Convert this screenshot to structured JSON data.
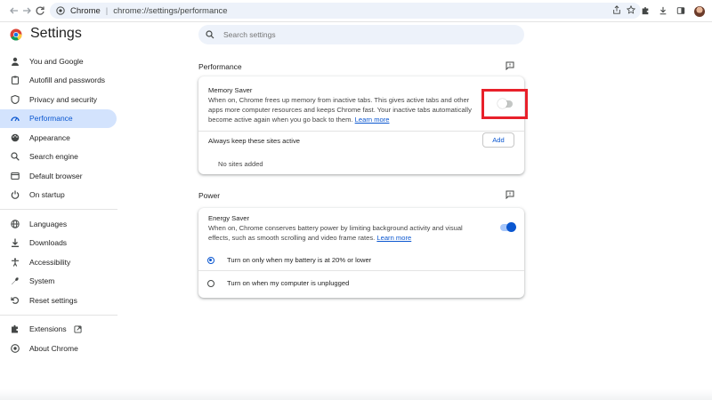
{
  "browser": {
    "chip_label": "Chrome",
    "url": "chrome://settings/performance"
  },
  "header": {
    "title": "Settings",
    "search_placeholder": "Search settings"
  },
  "sidebar": {
    "items": [
      {
        "label": "You and Google",
        "icon": "person-icon"
      },
      {
        "label": "Autofill and passwords",
        "icon": "clipboard-icon"
      },
      {
        "label": "Privacy and security",
        "icon": "shield-icon"
      },
      {
        "label": "Performance",
        "icon": "speedometer-icon",
        "active": true
      },
      {
        "label": "Appearance",
        "icon": "palette-icon"
      },
      {
        "label": "Search engine",
        "icon": "search-icon"
      },
      {
        "label": "Default browser",
        "icon": "browser-icon"
      },
      {
        "label": "On startup",
        "icon": "power-icon"
      },
      {
        "label": "Languages",
        "icon": "globe-icon"
      },
      {
        "label": "Downloads",
        "icon": "download-icon"
      },
      {
        "label": "Accessibility",
        "icon": "accessibility-icon"
      },
      {
        "label": "System",
        "icon": "wrench-icon"
      },
      {
        "label": "Reset settings",
        "icon": "reset-icon"
      },
      {
        "label": "Extensions",
        "icon": "puzzle-icon"
      },
      {
        "label": "About Chrome",
        "icon": "chrome-logo-icon"
      }
    ]
  },
  "performance": {
    "section_title": "Performance",
    "memory_saver": {
      "title": "Memory Saver",
      "description": "When on, Chrome frees up memory from inactive tabs. This gives active tabs and other apps more computer resources and keeps Chrome fast. Your inactive tabs automatically become active again when you go back to them.",
      "learn_more": "Learn more",
      "enabled": false
    },
    "always_keep_label": "Always keep these sites active",
    "add_button": "Add",
    "no_sites": "No sites added"
  },
  "power": {
    "section_title": "Power",
    "energy_saver": {
      "title": "Energy Saver",
      "description": "When on, Chrome conserves battery power by limiting background activity and visual effects, such as smooth scrolling and video frame rates.",
      "learn_more": "Learn more",
      "enabled": true
    },
    "options": [
      {
        "label": "Turn on only when my battery is at 20% or lower",
        "selected": true
      },
      {
        "label": "Turn on when my computer is unplugged",
        "selected": false
      }
    ]
  },
  "colors": {
    "accent": "#0b57d0",
    "active_nav_bg": "#d3e3fd",
    "highlight_box": "#e8202a"
  }
}
